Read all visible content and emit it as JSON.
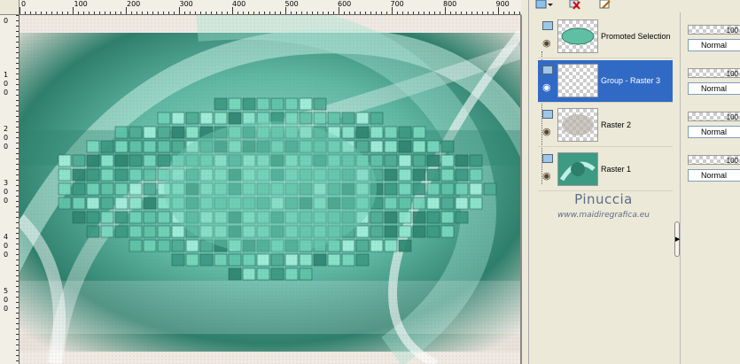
{
  "ruler": {
    "top_labels": [
      "0",
      "100",
      "200",
      "300",
      "400",
      "500",
      "600",
      "700",
      "800",
      "900"
    ],
    "left_labels": [
      "0",
      "1\n0\n0",
      "2\n0\n0",
      "3\n0\n0",
      "4\n0\n0",
      "5\n0\n0"
    ]
  },
  "layers": {
    "items": [
      {
        "name": "Promoted Selection",
        "selected": false
      },
      {
        "name": "Group - Raster 3",
        "selected": true
      },
      {
        "name": "Raster 2",
        "selected": false
      },
      {
        "name": "Raster 1",
        "selected": false
      }
    ]
  },
  "watermark": {
    "title": "Pinuccia",
    "url": "www.maidiregrafica.eu"
  },
  "props": [
    {
      "opacity": "100",
      "blend": "Normal"
    },
    {
      "opacity": "100",
      "blend": "Normal"
    },
    {
      "opacity": "100",
      "blend": "Normal"
    },
    {
      "opacity": "100",
      "blend": "Normal"
    }
  ],
  "colors": {
    "selection": "#316ac5",
    "canvas_teal": "#5fbfa2",
    "canvas_dark": "#1f6e5c"
  }
}
